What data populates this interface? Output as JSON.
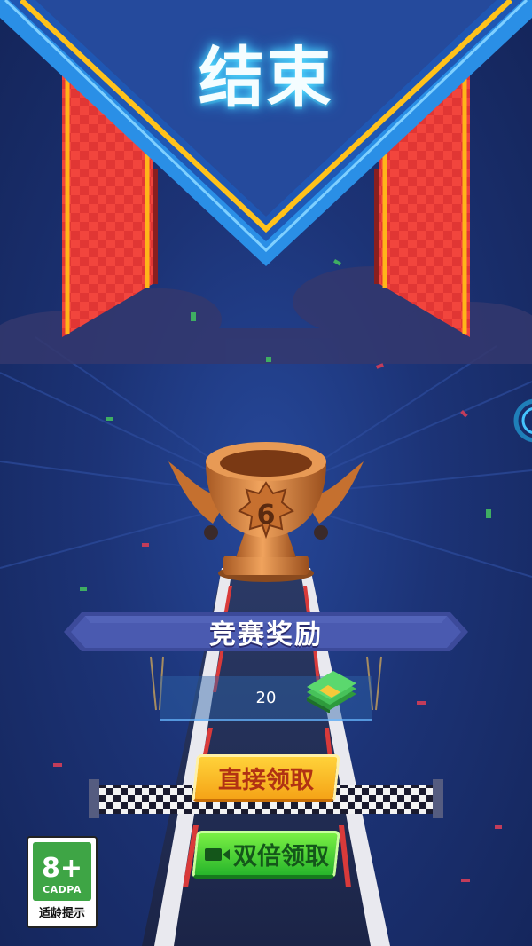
{
  "header": {
    "title": "结束"
  },
  "trophy": {
    "rank": "6"
  },
  "reward_panel": {
    "label": "竞赛奖励",
    "amount": "20",
    "currency_icon": "cash-stack-icon"
  },
  "buttons": {
    "direct_claim": "直接领取",
    "double_claim": "双倍领取"
  },
  "age_rating": {
    "age": "8+",
    "org": "CADPA",
    "tip": "适龄提示"
  },
  "colors": {
    "banner_blue": "#2a8fe6",
    "banner_gold": "#ffc21a",
    "flag_red": "#f2453d",
    "trophy_bronze": "#d98a45",
    "button_orange": "#f5a417",
    "button_green": "#27b52b"
  }
}
